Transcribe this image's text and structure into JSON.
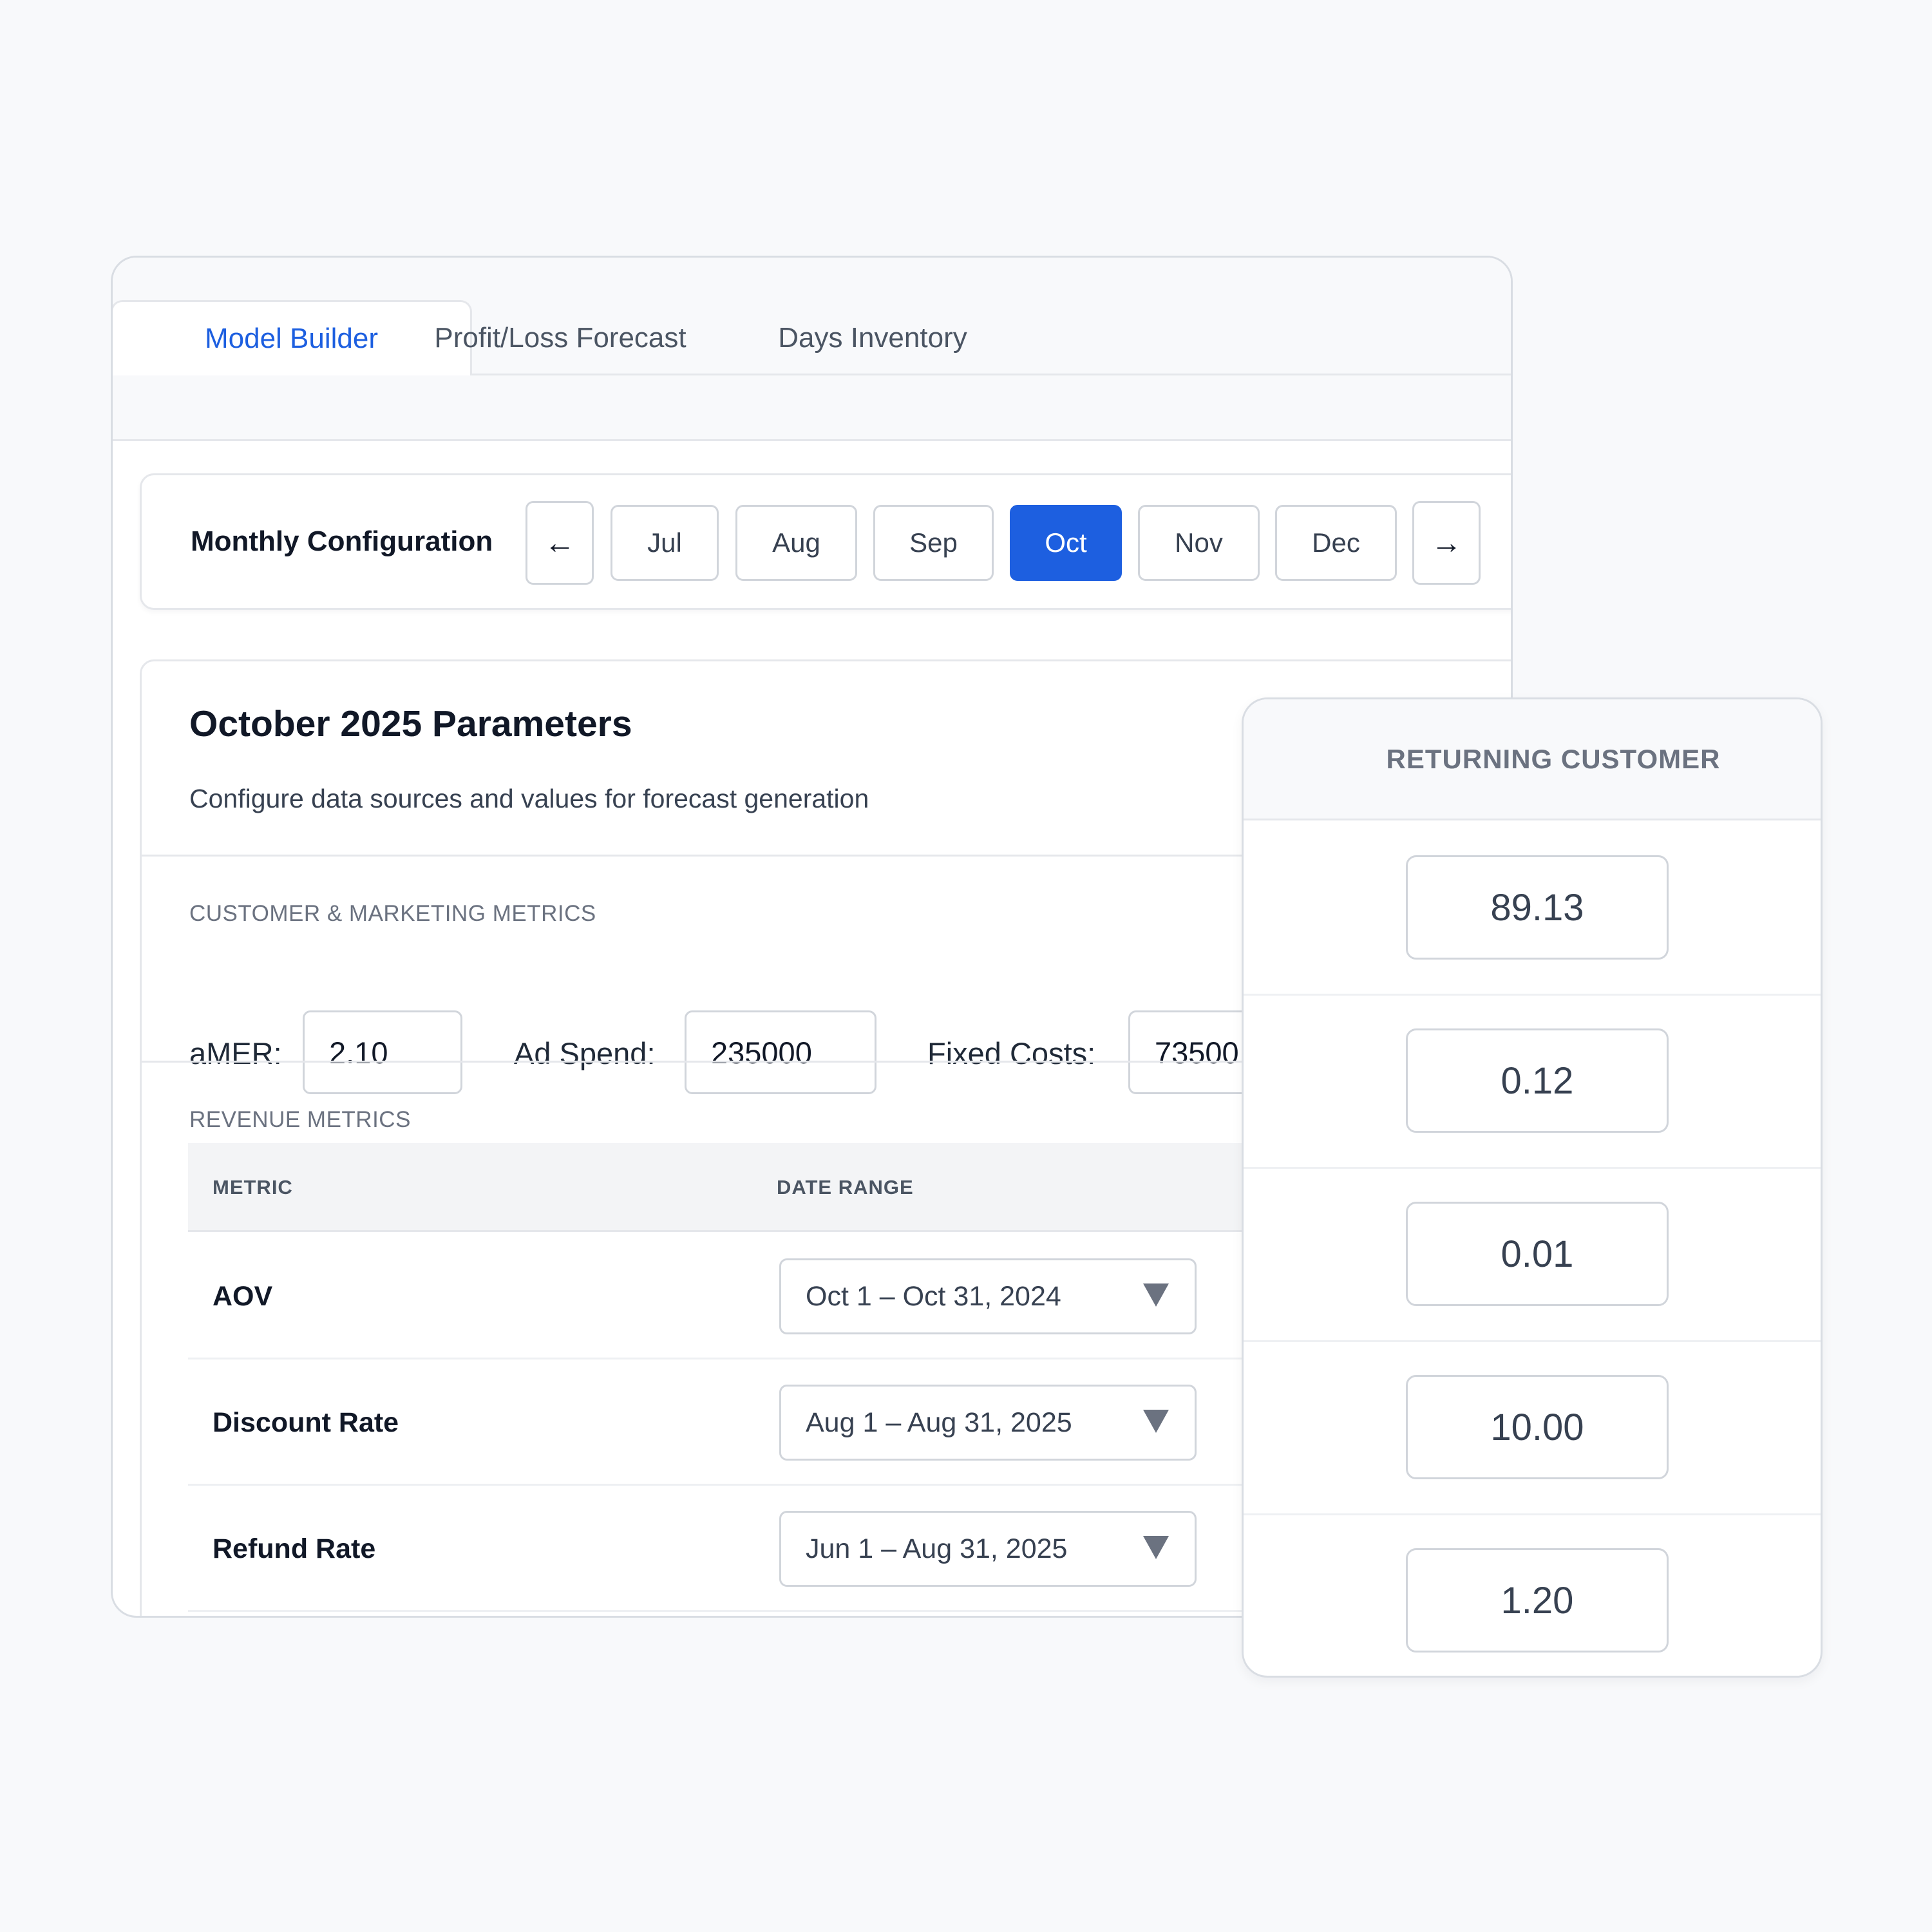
{
  "tabs": [
    {
      "label": "Model Builder",
      "active": true
    },
    {
      "label": "Profit/Loss Forecast",
      "active": false
    },
    {
      "label": "Days Inventory",
      "active": false
    }
  ],
  "monthly_config": {
    "title": "Monthly Configuration",
    "prev_icon": "←",
    "next_icon": "→",
    "months": [
      "Jul",
      "Aug",
      "Sep",
      "Oct",
      "Nov",
      "Dec"
    ],
    "selected": "Oct"
  },
  "params": {
    "title": "October 2025 Parameters",
    "subtitle": "Configure data sources and values for forecast generation",
    "customer_section_label": "CUSTOMER & MARKETING METRICS",
    "fields": {
      "amer_label": "aMER:",
      "amer_value": "2.10",
      "ad_spend_label": "Ad Spend:",
      "ad_spend_value": "235000",
      "fixed_costs_label": "Fixed Costs:",
      "fixed_costs_value": "73500"
    },
    "revenue_section_label": "REVENUE METRICS",
    "table": {
      "columns": [
        "METRIC",
        "DATE RANGE"
      ],
      "rows": [
        {
          "metric": "AOV",
          "date_range": "Oct 1 – Oct 31, 2024"
        },
        {
          "metric": "Discount Rate",
          "date_range": "Aug 1 – Aug 31, 2025"
        },
        {
          "metric": "Refund Rate",
          "date_range": "Jun 1 – Aug 31, 2025"
        }
      ]
    }
  },
  "returning_customer": {
    "header": "RETURNING CUSTOMER",
    "values": [
      "89.13",
      "0.12",
      "0.01",
      "10.00",
      "1.20"
    ]
  },
  "colors": {
    "accent": "#1d5fe0",
    "background": "#f8f9fb",
    "border": "#d1d5db"
  }
}
